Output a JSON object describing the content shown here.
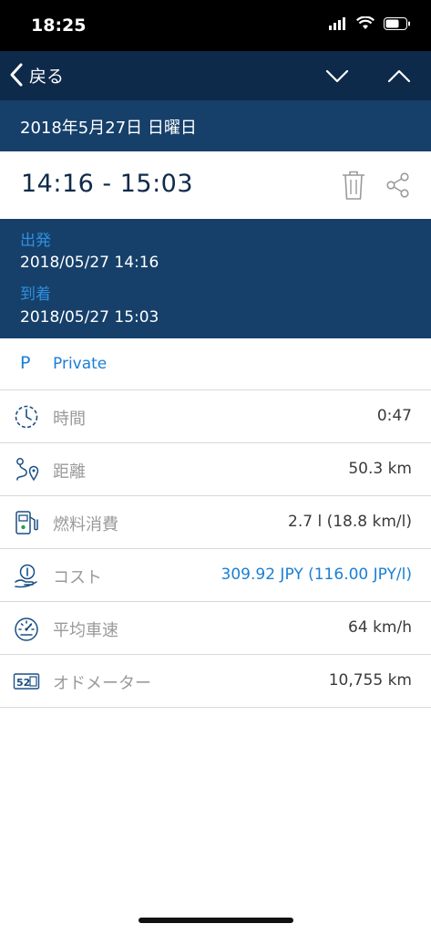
{
  "status_bar": {
    "time": "18:25"
  },
  "nav": {
    "back_label": "戻る"
  },
  "date_header": {
    "date": "2018年5月27日 日曜日"
  },
  "trip": {
    "time_range": "14:16 - 15:03",
    "departure_label": "出発",
    "departure_value": "2018/05/27 14:16",
    "arrival_label": "到着",
    "arrival_value": "2018/05/27 15:03"
  },
  "category": {
    "letter": "P",
    "label": "Private"
  },
  "details": {
    "duration": {
      "label": "時間",
      "value": "0:47"
    },
    "distance": {
      "label": "距離",
      "value": "50.3 km"
    },
    "fuel": {
      "label": "燃料消費",
      "value": "2.7 l (18.8 km/l)"
    },
    "cost": {
      "label": "コスト",
      "value": "309.92 JPY (116.00 JPY/l)"
    },
    "avg_speed": {
      "label": "平均車速",
      "value": "64 km/h"
    },
    "odometer": {
      "label": "オドメーター",
      "value": "10,755 km"
    }
  },
  "colors": {
    "nav_bg": "#0e2a4a",
    "header_bg": "#16406a",
    "accent": "#1a7fd4"
  }
}
